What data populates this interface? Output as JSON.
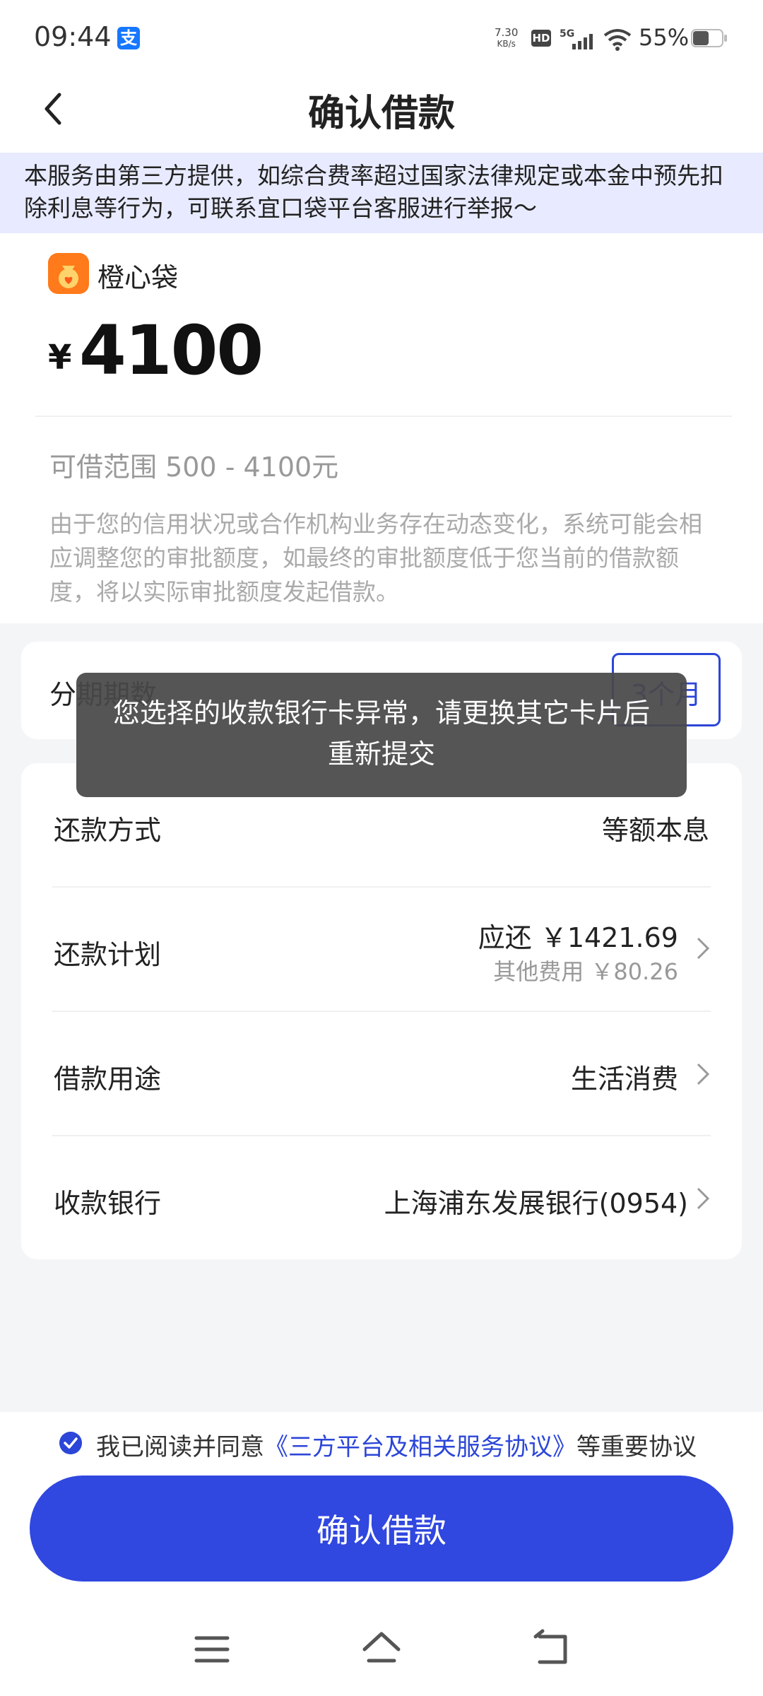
{
  "status_bar": {
    "time": "09:44",
    "app_icon": "支",
    "net_speed_top": "7.30",
    "net_speed_bottom": "KB/s",
    "hd": "HD",
    "network": "5G",
    "battery": "55%"
  },
  "header": {
    "title": "确认借款",
    "back_icon": "chevron-left-icon"
  },
  "notice": {
    "text": "本服务由第三方提供，如综合费率超过国家法律规定或本金中预先扣除利息等行为，可联系宜口袋平台客服进行举报～"
  },
  "loan": {
    "brand_name": "橙心袋",
    "currency": "¥",
    "amount": "4100",
    "range": "可借范围 500 - 4100元",
    "note": "由于您的信用状况或合作机构业务存在动态变化，系统可能会相应调整您的审批额度，如最终的审批额度低于您当前的借款额度，将以实际审批额度发起借款。"
  },
  "period": {
    "label": "分期期数",
    "value": "3个月"
  },
  "details": {
    "repay_method": {
      "label": "还款方式",
      "value": "等额本息"
    },
    "repay_plan": {
      "label": "还款计划",
      "value": "应还 ￥1421.69",
      "sub": "其他费用 ￥80.26"
    },
    "purpose": {
      "label": "借款用途",
      "value": "生活消费"
    },
    "bank": {
      "label": "收款银行",
      "value": "上海浦东发展银行(0954)"
    }
  },
  "toast": {
    "line1": "您选择的收款银行卡异常，请更换其它卡片后",
    "line2": "重新提交"
  },
  "agreement": {
    "prefix": "我已阅读并同意",
    "link": "《三方平台及相关服务协议》",
    "suffix": "等重要协议"
  },
  "confirm_button": "确认借款",
  "colors": {
    "accent": "#3047e0",
    "notice_bg": "#e8ebff",
    "toast_bg": "#484848",
    "brand": "#ff7a1a"
  }
}
